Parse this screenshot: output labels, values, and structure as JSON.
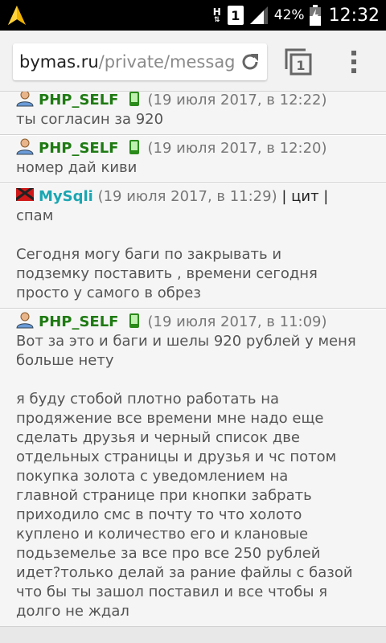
{
  "status_bar": {
    "network_type": "H",
    "sim_slot": "1",
    "battery": "42%",
    "time": "12:32"
  },
  "browser": {
    "url_host": "bymas.ru",
    "url_path": "/private/messag",
    "tab_count": "1"
  },
  "messages": [
    {
      "nick": "PHP_SELF",
      "date": "(19 июля 2017, в 12:22)",
      "lines": [
        "ты согласин за 920"
      ]
    },
    {
      "nick": "PHP_SELF",
      "date": "(19 июля 2017, в 12:20)",
      "lines": [
        "номер дай киви"
      ]
    },
    {
      "nick": "MySqli",
      "date": "(19 июля 2017, в 11:29)",
      "actions": "| цит |",
      "lines": [
        "спам",
        "",
        "Сегодня могу баги по закрывать и",
        "подземку поставить , времени сегодня",
        "просто у самого в обрез"
      ]
    },
    {
      "nick": "PHP_SELF",
      "date": "(19 июля 2017, в 11:09)",
      "lines": [
        "Вот за это и баги и шелы 920 рублей у меня",
        "больше нету",
        "",
        "я буду стобой плотно работать на",
        "продяжение все времени мне надо еще",
        "сделать друзья и черный список две",
        "отдельных страницы и друзья и чс потом",
        "покупка золота с уведомлением на",
        "главной странице при кнопки забрать",
        "приходило смс в почту то что холото",
        "куплено и количество его и клановые",
        "подьземелье за все про все 250 рублей",
        "идет?только делай за рание файлы с базой",
        "что бы ты зашол поставил и все чтобы я",
        "долго не ждал"
      ]
    }
  ]
}
